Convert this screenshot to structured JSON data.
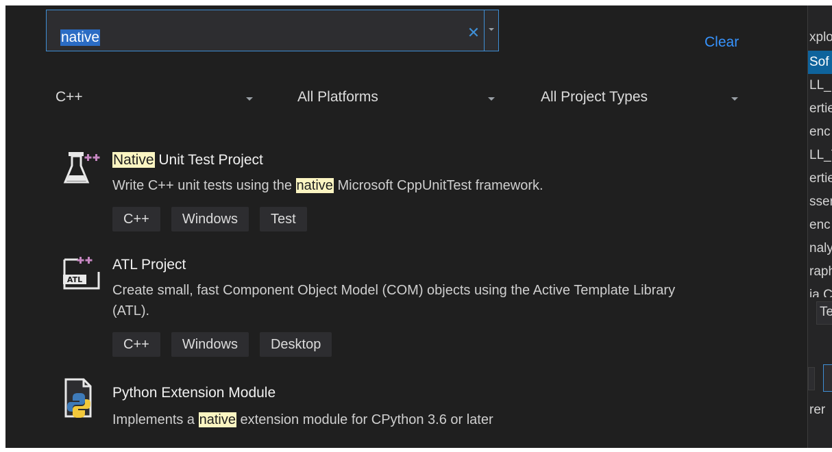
{
  "search": {
    "value": "native",
    "clear_icon": "close-icon",
    "dropdown_icon": "chevron-down-icon"
  },
  "clear_link": "Clear",
  "filters": [
    {
      "label": "C++"
    },
    {
      "label": "All Platforms"
    },
    {
      "label": "All Project Types"
    }
  ],
  "templates": [
    {
      "icon": "flask-test-icon",
      "title_hl": "Native",
      "title_rest": " Unit Test Project",
      "desc_before": "Write C++ unit tests using the ",
      "desc_hl": "native",
      "desc_after": " Microsoft CppUnitTest framework.",
      "tags": [
        "C++",
        "Windows",
        "Test"
      ]
    },
    {
      "icon": "atl-project-icon",
      "icon_label": "ATL",
      "title": "ATL Project",
      "desc": "Create small, fast Component Object Model (COM) objects using the Active Template Library (ATL).",
      "tags": [
        "C++",
        "Windows",
        "Desktop"
      ]
    },
    {
      "icon": "python-file-icon",
      "title": "Python Extension Module",
      "desc_before": "Implements a ",
      "desc_hl": "native",
      "desc_after": " extension module for CPython 3.6 or later"
    }
  ],
  "right_panel": {
    "rows": [
      "xplo",
      "Sof",
      "LL_N",
      "ertie",
      "enc",
      "LL_T",
      "ertie",
      "ssen",
      "enc",
      "naly",
      "raph",
      "ia C"
    ],
    "tab": "Te",
    "footer": "rer"
  },
  "colors": {
    "accent": "#3f8fd6",
    "highlight": "#fbf5c2",
    "link": "#3794ff",
    "background": "#1f1f1f"
  }
}
